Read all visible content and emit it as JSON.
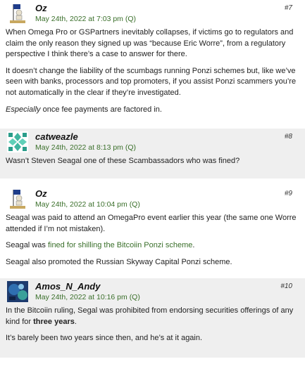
{
  "comments": [
    {
      "author": "Oz",
      "date": "May 24th, 2022 at 7:03 pm",
      "quote": "(Q)",
      "number": "#7",
      "avatar_icon": "skeleton-flag-avatar",
      "paragraphs": [
        "When Omega Pro or GSPartners inevitably collapses, if victims go to regulators and claim the only reason they signed up was “because Eric Worre”, from a regulatory perspective I think there’s a case to answer for there.",
        "It doesn’t change the liability of the scumbags running Ponzi schemes but, like we’ve seen with banks, processors and top promoters, if you assist Ponzi scammers you’re not automatically in the clear if they’re investigated."
      ],
      "p3_em": "Especially",
      "p3_rest": " once fee payments are factored in."
    },
    {
      "author": "catweazle",
      "date": "May 24th, 2022 at 8:13 pm",
      "quote": "(Q)",
      "number": "#8",
      "avatar_icon": "teal-pattern-avatar",
      "paragraphs": [
        "Wasn’t Steven Seagal one of these Scambassadors who was fined?"
      ]
    },
    {
      "author": "Oz",
      "date": "May 24th, 2022 at 10:04 pm",
      "quote": "(Q)",
      "number": "#9",
      "avatar_icon": "skeleton-flag-avatar",
      "paragraphs": [
        "Seagal was paid to attend an OmegaPro event earlier this year (the same one Worre attended if I’m not mistaken).",
        "Seagal also promoted the Russian Skyway Capital Ponzi scheme."
      ],
      "p2_pre": "Seagal was ",
      "p2_link": "fined for shilling the Bitcoiin Ponzi scheme",
      "p2_post": "."
    },
    {
      "author": "Amos_N_Andy",
      "date": "May 24th, 2022 at 10:16 pm",
      "quote": "(Q)",
      "number": "#10",
      "avatar_icon": "abstract-photo-avatar",
      "p1_pre": "In the Bitcoiin ruling, Segal was prohibited from endorsing securities offerings of any kind for ",
      "p1_bold": "three years",
      "p1_post": ".",
      "paragraphs": [
        "It’s barely been two years since then, and he’s at it again."
      ]
    }
  ]
}
